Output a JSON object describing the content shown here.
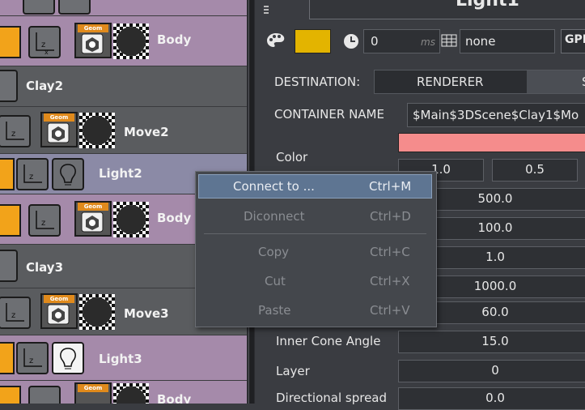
{
  "tree": {
    "rows": [
      {
        "label": "Body",
        "kind": "body"
      },
      {
        "label": "Clay2",
        "kind": "clay"
      },
      {
        "label": "Move2",
        "kind": "move"
      },
      {
        "label": "Light2",
        "kind": "light"
      },
      {
        "label": "Body",
        "kind": "body"
      },
      {
        "label": "Clay3",
        "kind": "clay"
      },
      {
        "label": "Move3",
        "kind": "move"
      },
      {
        "label": "Light3",
        "kind": "light"
      },
      {
        "label": "Body",
        "kind": "body"
      }
    ],
    "geom_tag": "Geom"
  },
  "properties": {
    "title": "Light1",
    "time_value": "0",
    "time_unit": "ms",
    "grid_value": "none",
    "gpi_label": "GPI",
    "destination_label": "DESTINATION:",
    "destination_renderer": "RENDERER",
    "destination_other": "S",
    "container_label": "CONTAINER NAME",
    "container_value": "$Main$3DScene$Clay1$Mo",
    "color_label": "Color",
    "color_value": "#f58c8c",
    "color_r": "1.0",
    "color_g": "0.5",
    "values": [
      "500.0",
      "100.0",
      "1.0",
      "1000.0",
      "60.0"
    ],
    "inner_cone_label": "Inner Cone Angle",
    "inner_cone_value": "15.0",
    "layer_label": "Layer",
    "layer_value": "0",
    "directional_label": "Directional spread",
    "directional_value": "0.0"
  },
  "context_menu": {
    "items": [
      {
        "label": "Connect to ...",
        "shortcut": "Ctrl+M",
        "enabled": true
      },
      {
        "label": "Diconnect",
        "shortcut": "Ctrl+D",
        "enabled": false
      },
      {
        "label": "Copy",
        "shortcut": "Ctrl+C",
        "enabled": false
      },
      {
        "label": "Cut",
        "shortcut": "Ctrl+X",
        "enabled": false
      },
      {
        "label": "Paste",
        "shortcut": "Ctrl+V",
        "enabled": false
      }
    ]
  },
  "colors": {
    "accent_orange": "#f2a31a",
    "swatch_yellow": "#e3b400",
    "menu_highlight": "#5e7592"
  }
}
